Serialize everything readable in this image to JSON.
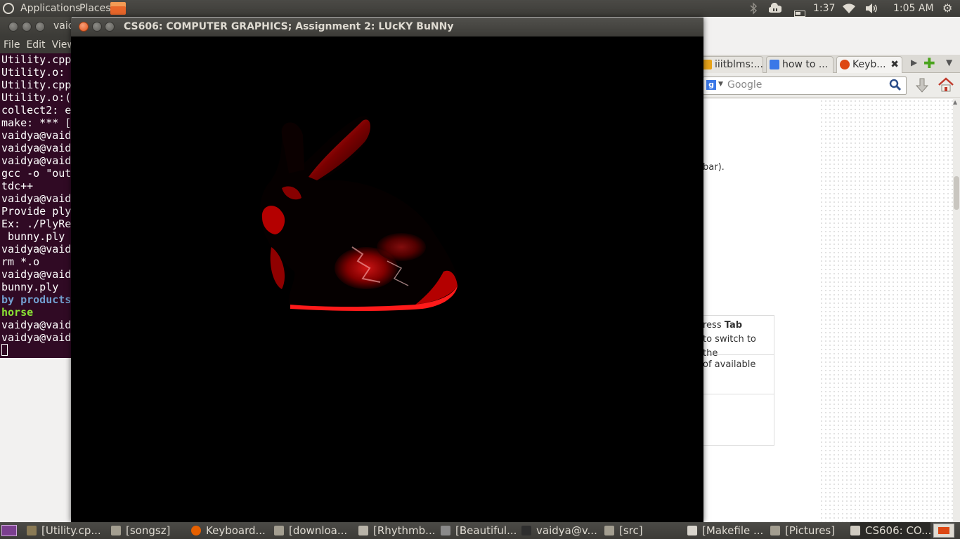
{
  "top_panel": {
    "menu_applications": "Applications",
    "menu_places": "Places",
    "battery_time": "1:37",
    "clock": "1:05 AM"
  },
  "terminal": {
    "title": "vaid",
    "menu": [
      "File",
      "Edit",
      "View"
    ],
    "lines": [
      {
        "text": "Utility.cpp",
        "style": ""
      },
      {
        "text": "Utility.o: ",
        "style": ""
      },
      {
        "text": "Utility.cpp",
        "style": ""
      },
      {
        "text": "Utility.o:(",
        "style": ""
      },
      {
        "text": "collect2: e",
        "style": ""
      },
      {
        "text": "make: *** [",
        "style": ""
      },
      {
        "text": "vaidya@vaid",
        "style": ""
      },
      {
        "text": "vaidya@vaid",
        "style": ""
      },
      {
        "text": "vaidya@vaid",
        "style": ""
      },
      {
        "text": "gcc -o \"out",
        "style": ""
      },
      {
        "text": "tdc++",
        "style": ""
      },
      {
        "text": "vaidya@vaid",
        "style": ""
      },
      {
        "text": "Provide ply",
        "style": ""
      },
      {
        "text": "Ex: ./PlyRe",
        "style": ""
      },
      {
        "text": " bunny.ply ",
        "style": ""
      },
      {
        "text": "vaidya@vaid",
        "style": ""
      },
      {
        "text": "rm *.o",
        "style": ""
      },
      {
        "text": "vaidya@vaid",
        "style": ""
      },
      {
        "text": "bunny.ply",
        "style": ""
      },
      {
        "text": "by products",
        "style": "blue"
      },
      {
        "text": "horse",
        "style": "green"
      },
      {
        "text": "vaidya@vaid",
        "style": ""
      },
      {
        "text": "vaidya@vaid",
        "style": ""
      }
    ]
  },
  "gl_window": {
    "title": "CS606: COMPUTER GRAPHICS; Assignment 2: LUcKY BuNNy"
  },
  "browser": {
    "tabs": [
      {
        "label": "iiitblms:...",
        "active": false,
        "favicon_color": "#e8a41a"
      },
      {
        "label": "how to ...",
        "active": false,
        "favicon_color": "#3b78e7"
      },
      {
        "label": "Keyb...",
        "active": true,
        "favicon_color": "#dd4814"
      }
    ],
    "search_placeholder": "Google",
    "page_text_1": "bar).",
    "table_row1_pre": "ress ",
    "table_row1_bold": "Tab",
    "table_row1_rest": " to switch to the",
    "table_row2": "of available"
  },
  "taskbar": [
    {
      "label": "[Utility.cp...",
      "icon": "gedit-icon"
    },
    {
      "label": "[songsz]",
      "icon": "folder-icon"
    },
    {
      "label": "Keyboard...",
      "icon": "firefox-icon"
    },
    {
      "label": "[downloa...",
      "icon": "folder-icon"
    },
    {
      "label": "[Rhythmb...",
      "icon": "rhythmbox-icon"
    },
    {
      "label": "[Beautiful...",
      "icon": "image-viewer-icon"
    },
    {
      "label": "vaidya@v...",
      "icon": "terminal-icon"
    },
    {
      "label": "[src]",
      "icon": "folder-icon"
    },
    {
      "label": "[Makefile ...",
      "icon": "text-editor-icon"
    },
    {
      "label": "[Pictures]",
      "icon": "folder-icon"
    },
    {
      "label": "CS606: CO...",
      "icon": "window-icon"
    }
  ]
}
